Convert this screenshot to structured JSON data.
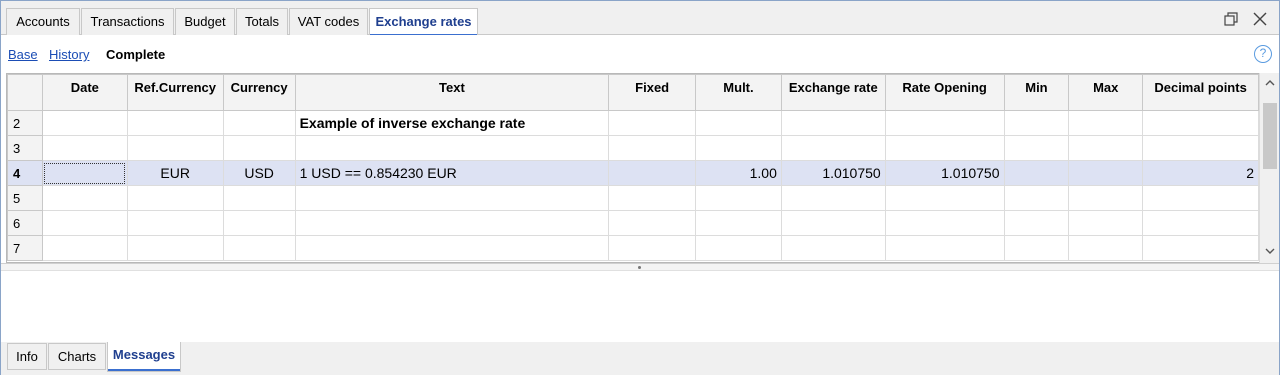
{
  "tabs": [
    {
      "label": "Accounts",
      "active": false
    },
    {
      "label": "Transactions",
      "active": false
    },
    {
      "label": "Budget",
      "active": false
    },
    {
      "label": "Totals",
      "active": false
    },
    {
      "label": "VAT codes",
      "active": false
    },
    {
      "label": "Exchange rates",
      "active": true
    }
  ],
  "views": {
    "base": "Base",
    "history": "History",
    "complete": "Complete"
  },
  "help_icon": "?",
  "table": {
    "columns": [
      "Date",
      "Ref.Currency",
      "Currency",
      "Text",
      "Fixed",
      "Mult.",
      "Exchange rate",
      "Rate Opening",
      "Min",
      "Max",
      "Decimal points"
    ],
    "rows": [
      {
        "num": "2",
        "date": "",
        "ref": "",
        "cur": "",
        "text": "Example of inverse exchange rate",
        "fixed": "",
        "mult": "",
        "rate": "",
        "opening": "",
        "min": "",
        "max": "",
        "dec": ""
      },
      {
        "num": "3",
        "date": "",
        "ref": "",
        "cur": "",
        "text": "",
        "fixed": "",
        "mult": "",
        "rate": "",
        "opening": "",
        "min": "",
        "max": "",
        "dec": ""
      },
      {
        "num": "4",
        "date": "",
        "ref": "EUR",
        "cur": "USD",
        "text": "1 USD == 0.854230 EUR",
        "fixed": "",
        "mult": "1.00",
        "rate": "1.010750",
        "opening": "1.010750",
        "min": "",
        "max": "",
        "dec": "2"
      },
      {
        "num": "5",
        "date": "",
        "ref": "",
        "cur": "",
        "text": "",
        "fixed": "",
        "mult": "",
        "rate": "",
        "opening": "",
        "min": "",
        "max": "",
        "dec": ""
      },
      {
        "num": "6",
        "date": "",
        "ref": "",
        "cur": "",
        "text": "",
        "fixed": "",
        "mult": "",
        "rate": "",
        "opening": "",
        "min": "",
        "max": "",
        "dec": ""
      },
      {
        "num": "7",
        "date": "",
        "ref": "",
        "cur": "",
        "text": "",
        "fixed": "",
        "mult": "",
        "rate": "",
        "opening": "",
        "min": "",
        "max": "",
        "dec": ""
      }
    ]
  },
  "bottom_tabs": [
    {
      "label": "Info",
      "active": false
    },
    {
      "label": "Charts",
      "active": false
    },
    {
      "label": "Messages",
      "active": true
    }
  ],
  "icons": {
    "restore": "restore-window-icon",
    "close": "close-icon",
    "help": "help-icon",
    "scroll_up": "chevron-up-icon",
    "scroll_down": "chevron-down-icon"
  },
  "colors": {
    "accent": "#3a6fcf",
    "active_tab_text": "#1f3f8f",
    "selected_row": "#dde2f3",
    "link": "#1b4db5"
  }
}
